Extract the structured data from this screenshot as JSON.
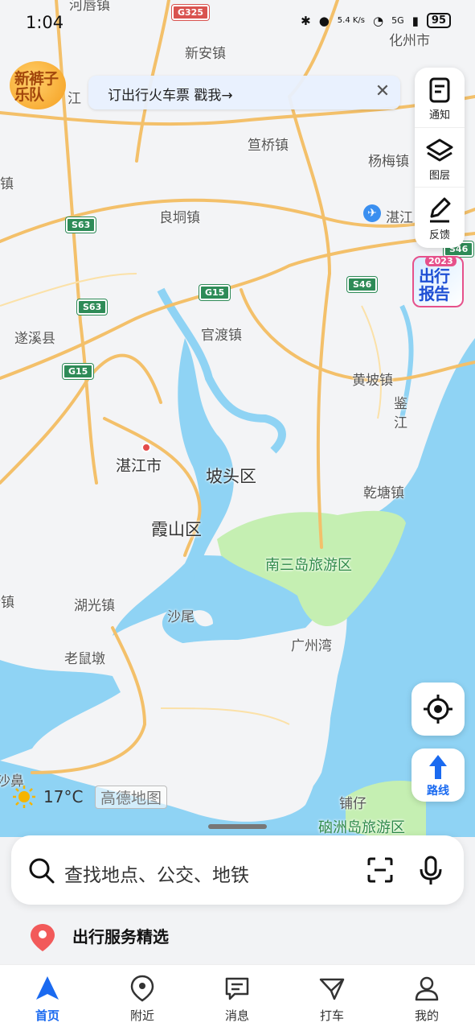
{
  "status_bar": {
    "time": "1:04",
    "net_speed": "5.4 K/s",
    "signal": "5G",
    "battery": "95"
  },
  "banner": {
    "logo_text": "新裤子乐队",
    "text": "订出行火车票  戳我→"
  },
  "toolbar": [
    {
      "label": "通知",
      "icon": "notification-icon"
    },
    {
      "label": "图层",
      "icon": "layers-icon"
    },
    {
      "label": "反馈",
      "icon": "feedback-icon"
    }
  ],
  "report_badge": {
    "year": "2023",
    "text": "出行报告"
  },
  "map": {
    "places": [
      {
        "key": "hetang",
        "name": "河唇镇"
      },
      {
        "key": "huazhou",
        "name": "化州市"
      },
      {
        "key": "xinan",
        "name": "新安镇"
      },
      {
        "key": "jiang",
        "name": "江"
      },
      {
        "key": "zhuqiao",
        "name": "笪桥镇"
      },
      {
        "key": "yangmei",
        "name": "杨梅镇"
      },
      {
        "key": "zhen_left",
        "name": "镇"
      },
      {
        "key": "lianghong",
        "name": "良垌镇"
      },
      {
        "key": "airport",
        "name": "湛江"
      },
      {
        "key": "suixi",
        "name": "遂溪县"
      },
      {
        "key": "guandu",
        "name": "官渡镇"
      },
      {
        "key": "huangpo",
        "name": "黄坡镇"
      },
      {
        "key": "jianjiang",
        "name": "鉴江"
      },
      {
        "key": "zhanjiang",
        "name": "湛江市"
      },
      {
        "key": "potou",
        "name": "坡头区"
      },
      {
        "key": "qiantang",
        "name": "乾塘镇"
      },
      {
        "key": "xiashan",
        "name": "霞山区"
      },
      {
        "key": "nansan",
        "name": "南三岛旅游区"
      },
      {
        "key": "xinzhen",
        "name": "新镇"
      },
      {
        "key": "huguang",
        "name": "湖光镇"
      },
      {
        "key": "shawei",
        "name": "沙尾"
      },
      {
        "key": "guangzhouwan",
        "name": "广州湾"
      },
      {
        "key": "laoshudun",
        "name": "老鼠墩"
      },
      {
        "key": "shabi",
        "name": "沙鼻"
      },
      {
        "key": "puzai",
        "name": "铺仔"
      },
      {
        "key": "naozhou",
        "name": "硇洲岛旅游区"
      }
    ],
    "road_shields": [
      {
        "key": "g325",
        "text": "G325",
        "color": "#d9534f"
      },
      {
        "key": "s63a",
        "text": "S63",
        "color": "#2e8b57"
      },
      {
        "key": "s63b",
        "text": "S63",
        "color": "#2e8b57"
      },
      {
        "key": "g15a",
        "text": "G15",
        "color": "#2e8b57"
      },
      {
        "key": "g15b",
        "text": "G15",
        "color": "#2e8b57"
      },
      {
        "key": "s46a",
        "text": "S46",
        "color": "#2e8b57"
      },
      {
        "key": "s46b",
        "text": "S46",
        "color": "#2e8b57"
      }
    ],
    "water_color": "#8fd3f4",
    "park_color": "#c5efb2",
    "road_color": "#f3c06a"
  },
  "weather": {
    "temp": "17°C",
    "icon": "sun-icon"
  },
  "brand": "高德地图",
  "route_button": {
    "label": "路线"
  },
  "search": {
    "placeholder": "查找地点、公交、地铁"
  },
  "service": {
    "title": "出行服务精选"
  },
  "tabs": [
    {
      "label": "首页",
      "icon": "home-nav-icon",
      "active": true
    },
    {
      "label": "附近",
      "icon": "nearby-pin-icon",
      "active": false
    },
    {
      "label": "消息",
      "icon": "message-icon",
      "active": false
    },
    {
      "label": "打车",
      "icon": "taxi-icon",
      "active": false
    },
    {
      "label": "我的",
      "icon": "profile-icon",
      "active": false
    }
  ],
  "accent_color": "#1a6af0"
}
